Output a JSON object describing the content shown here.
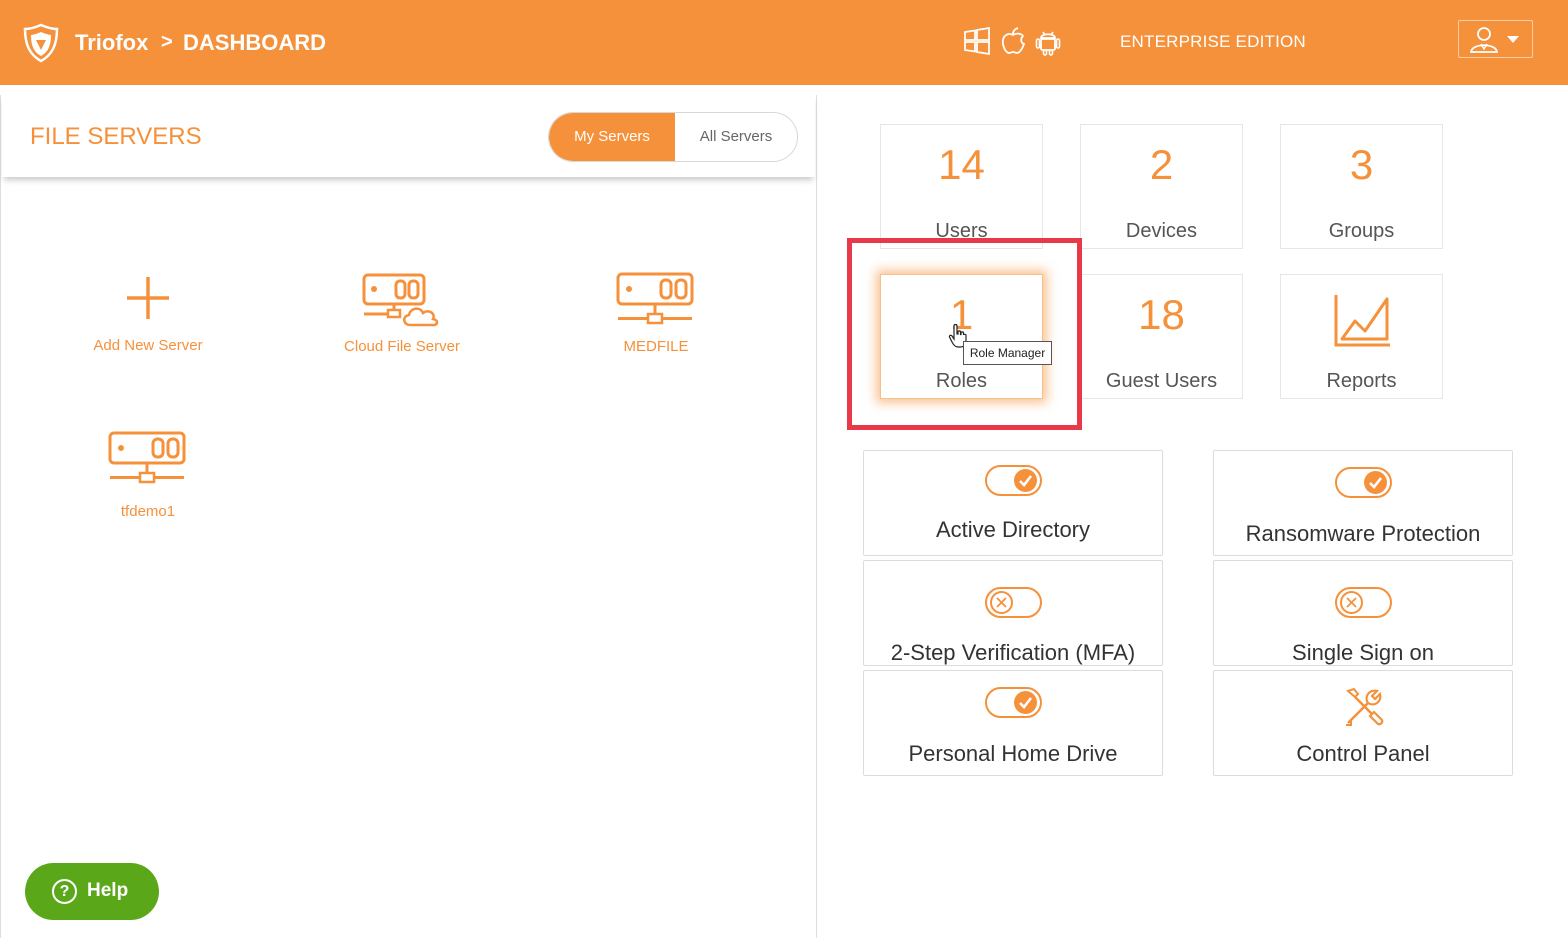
{
  "header": {
    "brand": "Triofox",
    "crumb_sep": ">",
    "crumb": "DASHBOARD",
    "edition": "ENTERPRISE EDITION",
    "platform_icons": [
      "windows-icon",
      "apple-icon",
      "android-icon"
    ],
    "user_icon": "user-icon",
    "bg_color": "#f5913a"
  },
  "file_servers": {
    "title": "FILE SERVERS",
    "tabs": [
      {
        "label": "My Servers",
        "active": true
      },
      {
        "label": "All Servers",
        "active": false
      }
    ],
    "servers": [
      {
        "label": "Add New Server",
        "icon": "plus-icon"
      },
      {
        "label": "Cloud File Server",
        "icon": "cloud-server-icon"
      },
      {
        "label": "MEDFILE",
        "icon": "server-icon"
      },
      {
        "label": "tfdemo1",
        "icon": "server-icon"
      }
    ]
  },
  "stats": [
    {
      "value": "14",
      "label": "Users"
    },
    {
      "value": "2",
      "label": "Devices"
    },
    {
      "value": "3",
      "label": "Groups"
    },
    {
      "value": "1",
      "label": "Roles"
    },
    {
      "value": "18",
      "label": "Guest Users"
    },
    {
      "value": "",
      "label": "Reports",
      "icon": "chart-icon"
    }
  ],
  "tooltip": "Role Manager",
  "features": [
    {
      "label": "Active Directory",
      "enabled": true
    },
    {
      "label": "Ransomware Protection",
      "enabled": true
    },
    {
      "label": "2-Step Verification (MFA)",
      "enabled": false
    },
    {
      "label": "Single Sign on",
      "enabled": false
    },
    {
      "label": "Personal Home Drive",
      "enabled": true
    },
    {
      "label": "Control Panel",
      "icon": "tools-icon"
    }
  ],
  "help": {
    "label": "Help",
    "color": "#5aa81a"
  },
  "colors": {
    "accent": "#f5913a",
    "highlight": "#e8394a"
  }
}
